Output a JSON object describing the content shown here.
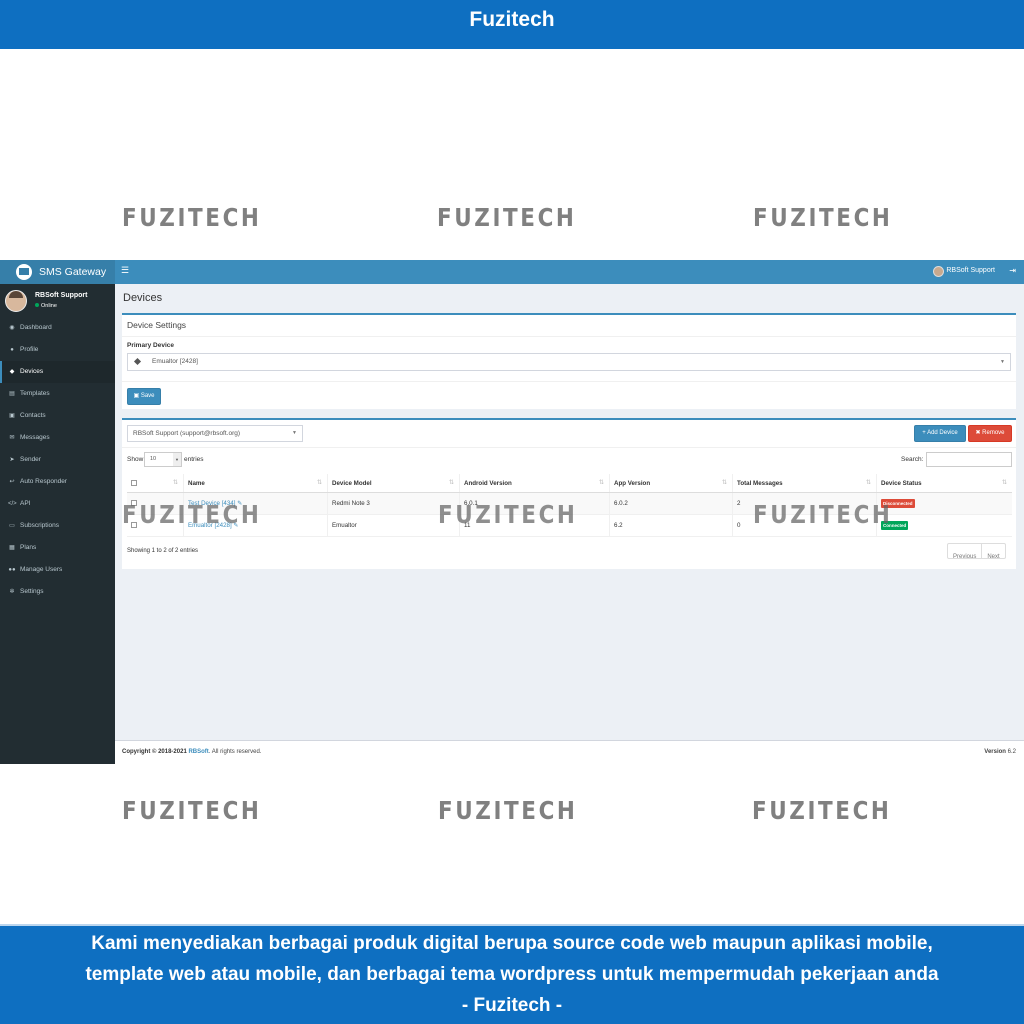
{
  "banner": {
    "top_title": "Fuzitech",
    "bottom_line1": "Kami menyediakan berbagai produk digital berupa source code web maupun aplikasi mobile,",
    "bottom_line2": "template web atau mobile, dan berbagai tema wordpress untuk mempermudah pekerjaan anda",
    "bottom_line3": "- Fuzitech -"
  },
  "watermark": "FUZITECH",
  "app": {
    "logo": "SMS Gateway",
    "header_user": "RBSoft Support",
    "sidebar_user": {
      "name": "RBSoft Support",
      "status": "Online"
    },
    "menu": [
      {
        "label": "Dashboard",
        "icon": "dashboard-icon",
        "glyph": "◉"
      },
      {
        "label": "Profile",
        "icon": "user-icon",
        "glyph": "●"
      },
      {
        "label": "Devices",
        "icon": "android-icon",
        "glyph": "◆"
      },
      {
        "label": "Templates",
        "icon": "template-icon",
        "glyph": "▤"
      },
      {
        "label": "Contacts",
        "icon": "address-card-icon",
        "glyph": "▣"
      },
      {
        "label": "Messages",
        "icon": "envelope-icon",
        "glyph": "✉"
      },
      {
        "label": "Sender",
        "icon": "paper-plane-icon",
        "glyph": "➤"
      },
      {
        "label": "Auto Responder",
        "icon": "reply-icon",
        "glyph": "↩"
      },
      {
        "label": "API",
        "icon": "code-icon",
        "glyph": "</>"
      },
      {
        "label": "Subscriptions",
        "icon": "money-icon",
        "glyph": "▭"
      },
      {
        "label": "Plans",
        "icon": "list-icon",
        "glyph": "▦"
      },
      {
        "label": "Manage Users",
        "icon": "users-icon",
        "glyph": "●●"
      },
      {
        "label": "Settings",
        "icon": "gear-icon",
        "glyph": "✲"
      }
    ],
    "active_menu": "Devices",
    "page_title": "Devices",
    "device_settings": {
      "title": "Device Settings",
      "primary_label": "Primary Device",
      "primary_value": "Emualtor [2428]",
      "save_label": "Save"
    },
    "devices": {
      "user_select": "RBSoft Support (support@rbsoft.org)",
      "add_label": "Add Device",
      "remove_label": "Remove",
      "show_label": "Show",
      "length_value": "10",
      "entries_label": "entries",
      "search_label": "Search:",
      "columns": [
        "Name",
        "Device Model",
        "Android Version",
        "App Version",
        "Total Messages",
        "Device Status"
      ],
      "rows": [
        {
          "name": "Test Device [434]",
          "model": "Redmi Note 3",
          "android": "6.0.1",
          "app": "6.0.2",
          "total": "2",
          "status": "Disconnected",
          "status_color": "#dd4b39"
        },
        {
          "name": "Emualtor [2428]",
          "model": "Emualtor",
          "android": "11",
          "app": "6.2",
          "total": "0",
          "status": "Connected",
          "status_color": "#00a65a"
        }
      ],
      "info": "Showing 1 to 2 of 2 entries",
      "prev_label": "Previous",
      "next_label": "Next"
    },
    "footer": {
      "copyright_prefix": "Copyright © 2018-2021 ",
      "company": "RBSoft",
      "suffix": ". All rights reserved.",
      "version_label": "Version",
      "version": "6.2"
    }
  }
}
